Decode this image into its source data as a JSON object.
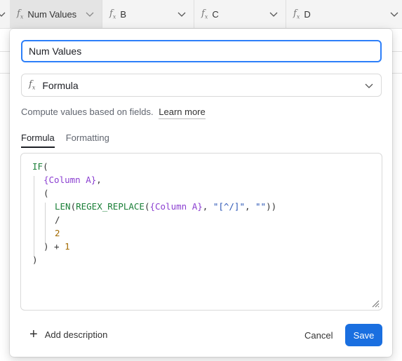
{
  "grid": {
    "columns": [
      {
        "label": "Num Values",
        "icon": "formula-icon",
        "active": true
      },
      {
        "label": "B",
        "icon": "formula-icon"
      },
      {
        "label": "C",
        "icon": "formula-icon"
      },
      {
        "label": "D",
        "icon": "formula-icon"
      }
    ]
  },
  "field_editor": {
    "name_value": "Num Values",
    "field_type": "Formula",
    "type_icon": "formula-icon",
    "description_text": "Compute values based on fields.",
    "learn_more": "Learn more",
    "tabs": [
      "Formula",
      "Formatting"
    ],
    "active_tab": "Formula",
    "formula_lines": [
      "IF(",
      "  {Column A},",
      "  (",
      "    LEN(REGEX_REPLACE({Column A}, \"[^/]\", \"\"))",
      "    /",
      "    2",
      "  ) + 1",
      ")"
    ],
    "add_description": "Add description",
    "cancel": "Cancel",
    "save": "Save"
  },
  "colors": {
    "accent": "#2d7ff9",
    "save_button": "#1a6fe0",
    "keyword": "#1a7f37",
    "field_ref": "#8b3fd1",
    "string": "#2b55b5",
    "number": "#a36a00"
  }
}
